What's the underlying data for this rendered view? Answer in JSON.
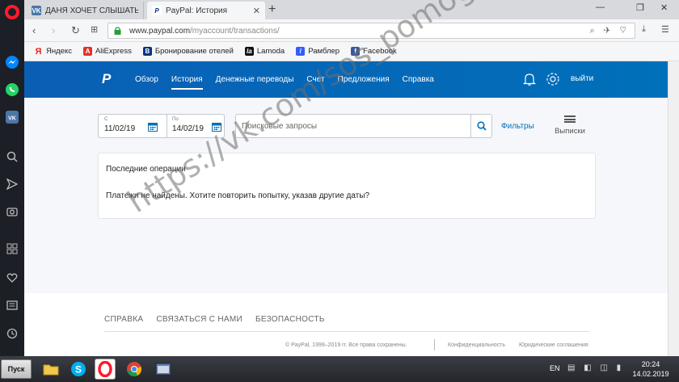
{
  "browser": {
    "tabs": [
      {
        "title": "ДАНЯ ХОЧЕТ СЛЫШАТЬ ДЕ",
        "icon": "vk-icon"
      },
      {
        "title": "PayPal: История",
        "icon": "paypal-icon",
        "close": "✕"
      }
    ],
    "new_tab": "+",
    "window_controls": {
      "minimize": "—",
      "restore": "❐",
      "close": "✕"
    },
    "url": {
      "host": "www.paypal.com",
      "path": "/myaccount/transactions/"
    },
    "bookmarks": [
      {
        "label": "Яндекс",
        "icon": "yandex-icon"
      },
      {
        "label": "AliExpress",
        "icon": "aliexpress-icon"
      },
      {
        "label": "Бронирование отелей",
        "icon": "booking-icon"
      },
      {
        "label": "Lamoda",
        "icon": "lamoda-icon"
      },
      {
        "label": "Рамблер",
        "icon": "rambler-icon"
      },
      {
        "label": "Facebook",
        "icon": "facebook-icon"
      }
    ]
  },
  "paypal": {
    "nav": [
      {
        "label": "Обзор"
      },
      {
        "label": "История",
        "active": true
      },
      {
        "label": "Денежные переводы"
      },
      {
        "label": "Счет"
      },
      {
        "label": "Предложения"
      },
      {
        "label": "Справка"
      }
    ],
    "logout": "выйти",
    "date_from": {
      "label": "С",
      "value": "11/02/19"
    },
    "date_to": {
      "label": "По",
      "value": "14/02/19"
    },
    "search_placeholder": "Поисковые запросы",
    "filters": "Фильтры",
    "statements": "Выписки",
    "recent_title": "Последние операции",
    "empty_message": "Платежи не найдены. Хотите повторить попытку, указав другие даты?",
    "footer_links": [
      "СПРАВКА",
      "СВЯЗАТЬСЯ С НАМИ",
      "БЕЗОПАСНОСТЬ"
    ],
    "copyright": "© PayPal, 1999–2019 гг. Все права сохранены.",
    "privacy": "Конфиденциальность",
    "legal": "Юридические соглашения"
  },
  "watermark": "https://vk.com/sos_pomogite_dane",
  "taskbar": {
    "start": "Пуск",
    "lang": "EN",
    "time": "20:24",
    "date": "14.02.2019"
  },
  "colors": {
    "paypal_blue": "#0070ba",
    "opera_red": "#ff1b2d",
    "sidebar": "#1c1f26"
  }
}
